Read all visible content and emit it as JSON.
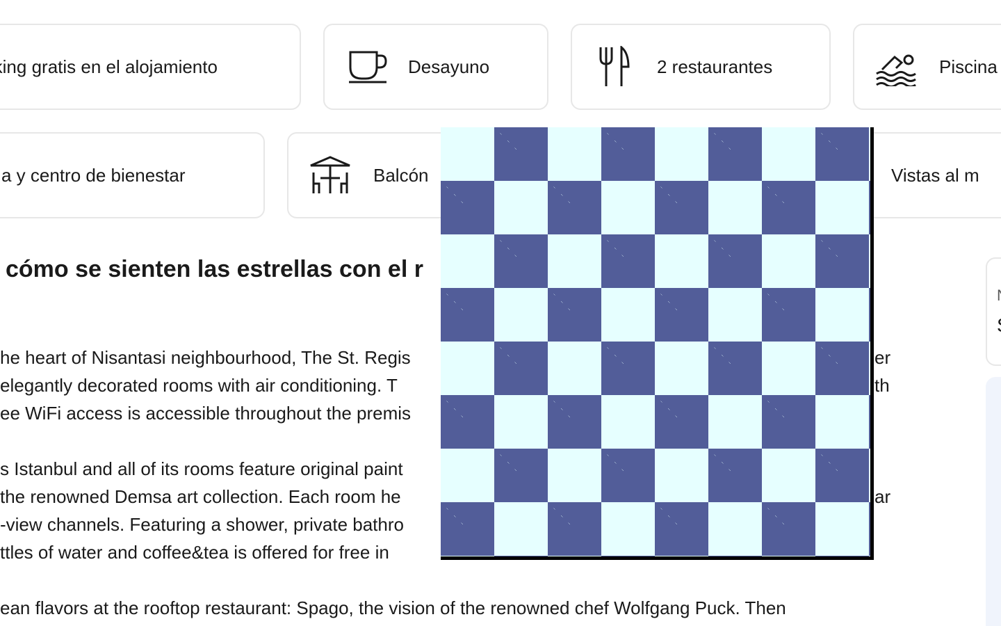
{
  "facilities_row1": [
    {
      "icon": "parking-icon",
      "label": "rking gratis en el alojamiento"
    },
    {
      "icon": "coffee-cup-icon",
      "label": "Desayuno"
    },
    {
      "icon": "fork-knife-icon",
      "label": "2 restaurantes"
    },
    {
      "icon": "swimmer-icon",
      "label": "Piscina"
    }
  ],
  "facilities_row2": [
    {
      "icon": "spa-icon",
      "label": "a y centro de bienestar"
    },
    {
      "icon": "patio-table-icon",
      "label": "Balcón"
    },
    {
      "icon": "sea-view-icon",
      "label": "Vistas al m"
    }
  ],
  "description": {
    "heading": "cómo se sienten las estrellas con el r",
    "lines": [
      "he heart of Nisantasi neighbourhood, The St. Regis",
      "elegantly decorated rooms with air conditioning. T",
      "ee WiFi access is accessible throughout the premis",
      "s Istanbul and all of its rooms feature original paint",
      "the renowned Demsa art collection. Each room he",
      "-view channels. Featuring a shower, private bathro",
      "ttles of water and coffee&tea is offered for free in",
      "ean flavors at the rooftop restaurant: Spago, the vision of the renowned chef Wolfgang Puck. Then"
    ],
    "fragments_right": [
      "er",
      "th",
      "ar"
    ]
  },
  "side_card": {
    "line1": "N",
    "line2": "S"
  }
}
